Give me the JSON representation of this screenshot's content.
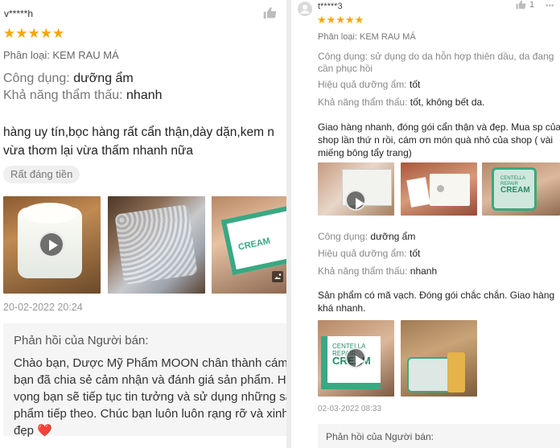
{
  "left_review": {
    "username": "v*****h",
    "rating_stars": 5,
    "category_label": "Phân loại: KEM RAU MÁ",
    "attributes": [
      {
        "label": "Công dụng:",
        "value": "dưỡng ẩm"
      },
      {
        "label": "Khả năng thẩm thấu:",
        "value": "nhanh"
      }
    ],
    "body_lines": [
      "hàng uy tín,bọc hàng rất cẩn thận,dày dặn,kem n",
      "vừa thơm lại vừa thấm nhanh nữa"
    ],
    "tag": "Rất đáng tiền",
    "media": [
      {
        "kind": "video",
        "subject": "open cream jar"
      },
      {
        "kind": "photo",
        "subject": "bubble-wrapped parcel"
      },
      {
        "kind": "photo",
        "subject": "cream box in hand",
        "badge": "image-icon"
      }
    ],
    "date": "20-02-2022 20:24",
    "seller_reply": {
      "title": "Phản hồi của Người bán:",
      "lines": [
        "Chào bạn, Dược Mỹ Phẩm MOON chân thành cám ơ",
        "bạn đã chia sẻ cảm nhận và đánh giá sản phẩm. H",
        "vọng bạn sẽ tiếp tục tin tưởng và sử dụng những sả",
        "phẩm tiếp theo. Chúc bạn luôn luôn rạng rỡ và xinh",
        "đẹp"
      ],
      "emoji": "❤️"
    }
  },
  "right_review": {
    "username": "t*****3",
    "likes": "1",
    "rating_stars": 5,
    "category_label": "Phân loại: KEM RAU MÁ",
    "usage_lines": [
      "Công dụng: sử dụng do da hỗn hợp thiên dầu, da đang",
      "cần phục hồi"
    ],
    "attributes": [
      {
        "label": "Hiệu quả dưỡng ẩm:",
        "value": "tốt"
      },
      {
        "label": "Khả năng thẩm thấu:",
        "value": "tốt, không bết da."
      }
    ],
    "body_lines": [
      "Giao hàng nhanh, đóng gói cẩn thận và đẹp. Mua sp của",
      "shop lần thứ n rồi, cám ơn món quà nhỏ của shop ( vài",
      "miếng bông tẩy trang)"
    ],
    "media_row_1": [
      {
        "kind": "video",
        "subject": "cream box in hand"
      },
      {
        "kind": "photo",
        "subject": "gift box"
      },
      {
        "kind": "photo",
        "subject": "cream jar in hand",
        "box_text": [
          "CENTELLA",
          "REPAIR",
          "CREAM"
        ]
      }
    ],
    "attributes_2": [
      {
        "label": "Công dụng:",
        "value": "dưỡng ẩm"
      },
      {
        "label": "Hiệu quả dưỡng ẩm:",
        "value": "tốt"
      },
      {
        "label": "Khả năng thẩm thấu:",
        "value": "nhanh"
      }
    ],
    "body_lines_2": [
      "Sản phẩm có mã vạch. Đóng gói chắc chắn. Giao hàng",
      "khá nhanh."
    ],
    "media_row_2": [
      {
        "kind": "video",
        "subject": "cream box",
        "box_text": [
          "CENTELLA",
          "REPAIR",
          "CREAM"
        ]
      },
      {
        "kind": "photo",
        "subject": "opened carton"
      }
    ],
    "date": "02-03-2022 08:33",
    "seller_reply": {
      "title": "Phản hồi của Người bán:"
    }
  },
  "colors": {
    "star": "#f6a700",
    "heart": "#e0304a",
    "tag_bg": "#efefef",
    "reply_bg": "#f5f5f5",
    "divider": "#ececec",
    "box_green": "#3aa882"
  },
  "icons": [
    "thumbs-up-icon",
    "star-icon",
    "play-icon",
    "image-icon",
    "avatar-icon"
  ]
}
